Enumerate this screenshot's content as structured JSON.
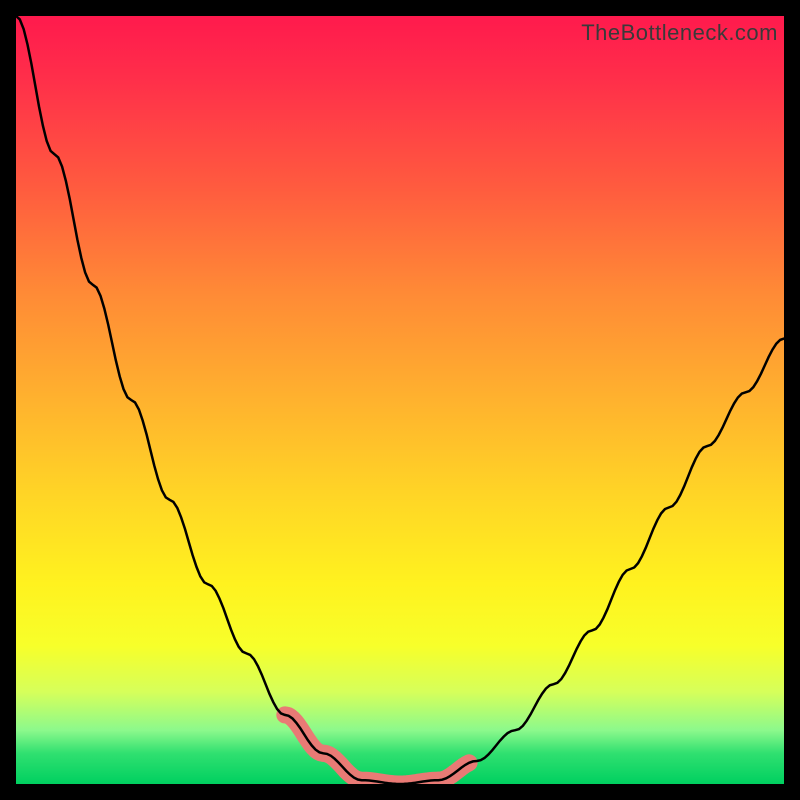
{
  "watermark": "TheBottleneck.com",
  "colors": {
    "curve": "#000000",
    "highlight": "#e97a75",
    "frame_border": "#000000",
    "gradient_top": "#ff1a4d",
    "gradient_bottom": "#00d060"
  },
  "chart_data": {
    "type": "line",
    "title": "",
    "xlabel": "",
    "ylabel": "",
    "x": [
      0.0,
      0.05,
      0.1,
      0.15,
      0.2,
      0.25,
      0.3,
      0.35,
      0.4,
      0.45,
      0.5,
      0.55,
      0.6,
      0.65,
      0.7,
      0.75,
      0.8,
      0.85,
      0.9,
      0.95,
      1.0
    ],
    "values": [
      1.0,
      0.82,
      0.65,
      0.5,
      0.37,
      0.26,
      0.17,
      0.09,
      0.04,
      0.005,
      0.0,
      0.005,
      0.03,
      0.07,
      0.13,
      0.2,
      0.28,
      0.36,
      0.44,
      0.51,
      0.58
    ],
    "ylim": [
      0,
      1
    ],
    "xlim": [
      0,
      1
    ],
    "grid": false,
    "legend": false,
    "highlight_segments_x": [
      [
        0.35,
        0.41
      ],
      [
        0.4,
        0.55
      ],
      [
        0.55,
        0.59
      ]
    ],
    "annotations": []
  }
}
